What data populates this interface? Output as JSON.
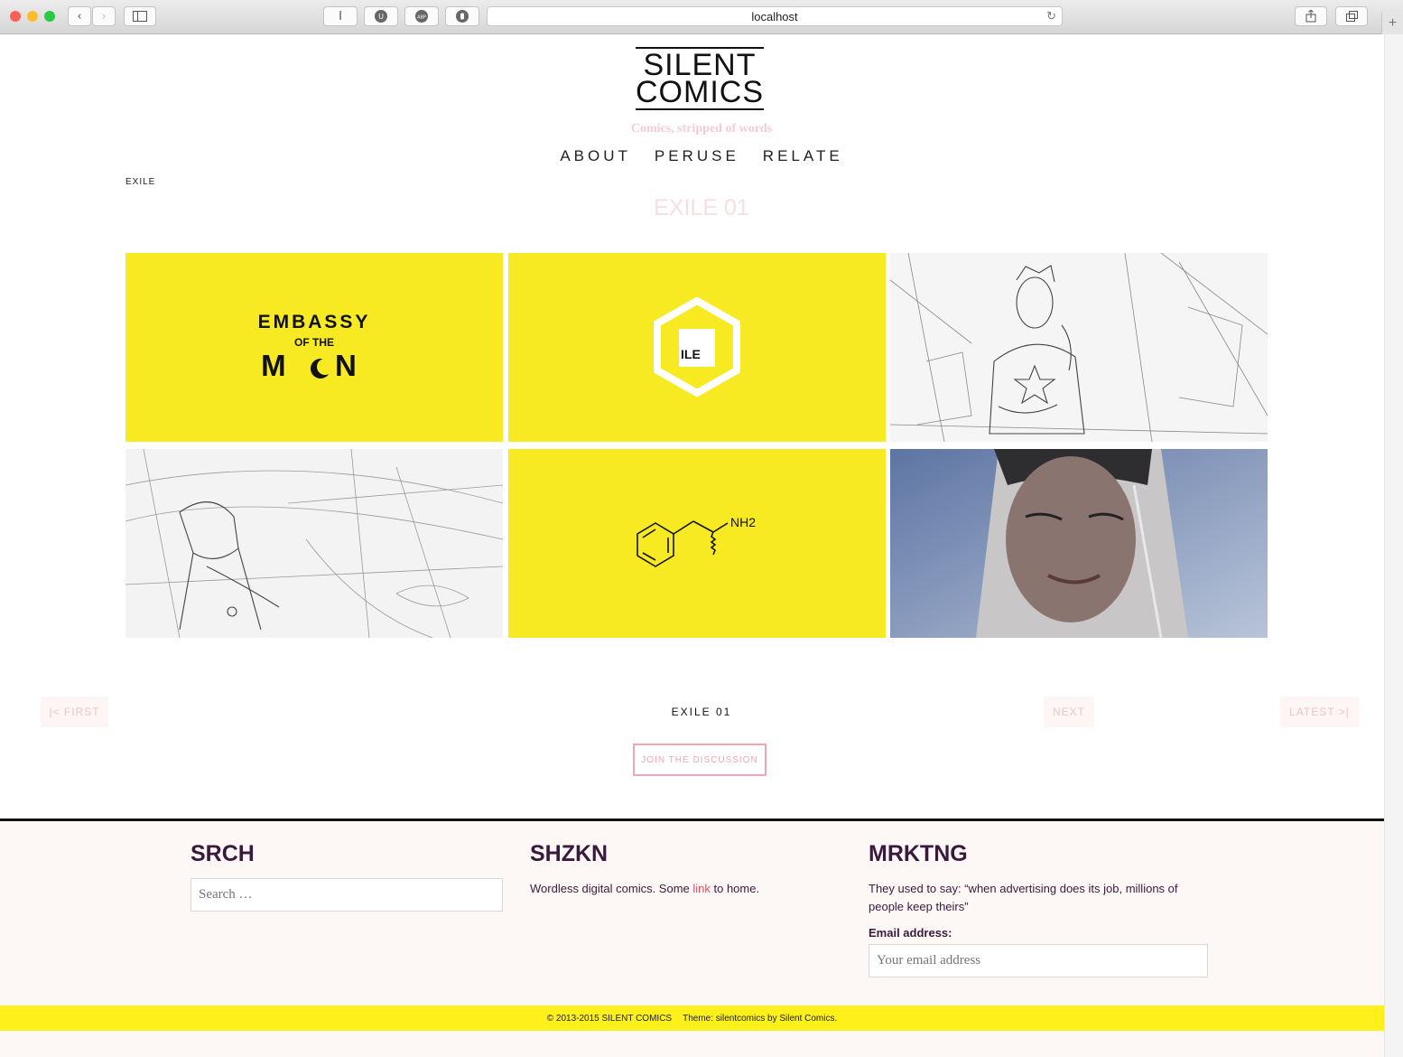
{
  "browser": {
    "url": "localhost"
  },
  "site": {
    "logo_line1": "SILENT",
    "logo_line2": "COMICS",
    "tagline": "Comics, stripped of words",
    "nav": [
      "ABOUT",
      "PERUSE",
      "RELATE"
    ]
  },
  "page": {
    "breadcrumb": "EXILE",
    "title": "EXILE 01"
  },
  "panels": {
    "embassy_line1": "EMBASSY",
    "embassy_line2": "OF THE",
    "embassy_line3": "M  N",
    "exile_badge": "ILE",
    "molecule_label": "NH2"
  },
  "pagination": {
    "first": "|< FIRST",
    "current": "EXILE 01",
    "next": "NEXT",
    "latest": "LATEST >|",
    "join": "JOIN THE DISCUSSION"
  },
  "footer": {
    "search_title": "SRCH",
    "search_placeholder": "Search …",
    "about_title": "SHZKN",
    "about_text_before": "Wordless digital comics. Some ",
    "about_link": "link",
    "about_text_after": " to home.",
    "marketing_title": "MRKTNG",
    "marketing_text": "They used to say: “when advertising does its job, millions of people keep theirs”",
    "email_label": "Email address:",
    "email_placeholder": "Your email address",
    "copyright": "© 2013-2015 SILENT COMICS",
    "theme_credit": "Theme: silentcomics by Silent Comics."
  },
  "colors": {
    "accent_yellow": "#f7ea22",
    "accent_pink": "#f1a6b6",
    "footer_heading": "#3a1a3c"
  }
}
